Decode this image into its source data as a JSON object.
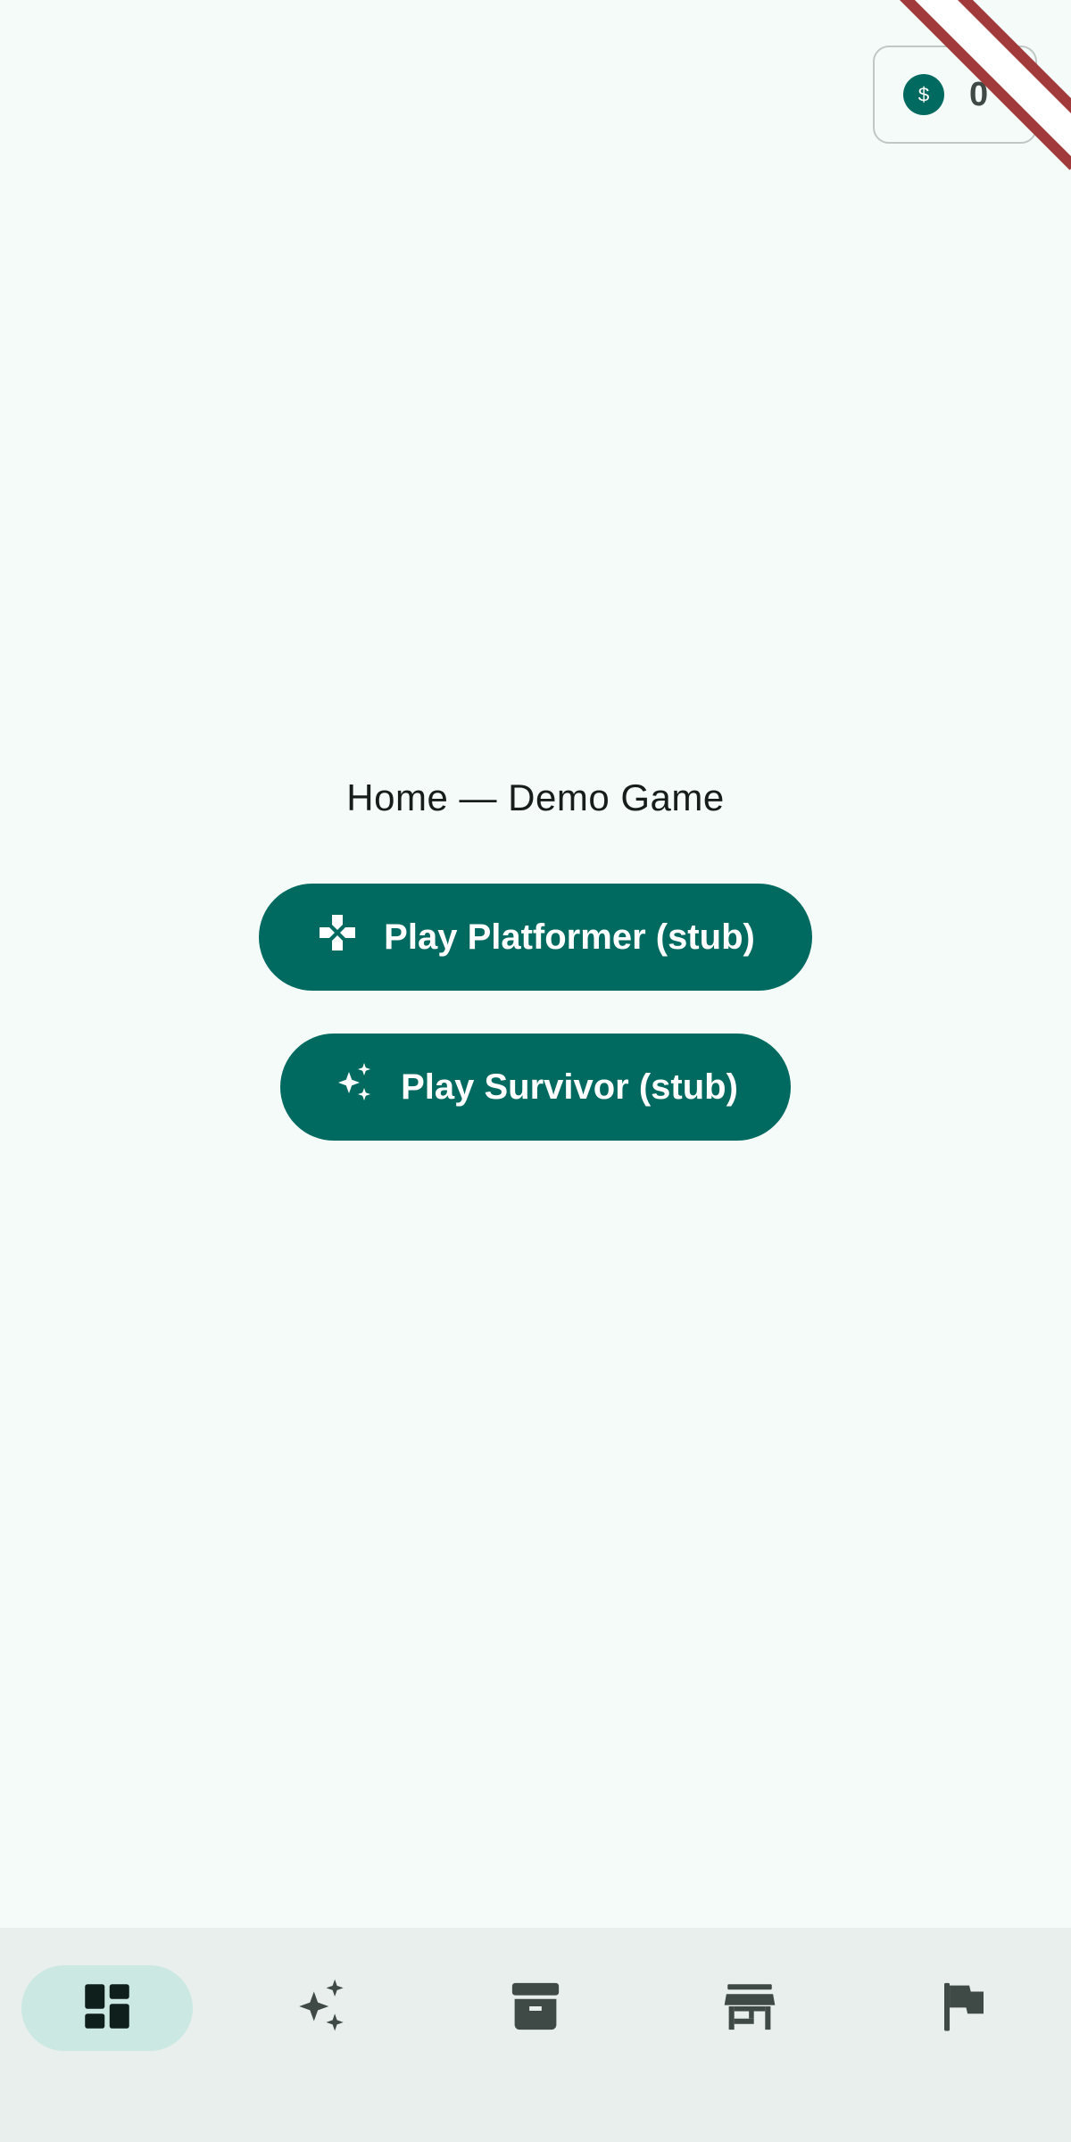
{
  "header": {
    "coins": {
      "icon": "dollar-coin-icon",
      "count": "0"
    }
  },
  "main": {
    "title": "Home — Demo Game",
    "buttons": [
      {
        "label": "Play Platformer (stub)",
        "icon": "gamepad-icon"
      },
      {
        "label": "Play Survivor (stub)",
        "icon": "sparkles-icon"
      }
    ]
  },
  "bottom_nav": {
    "items": [
      {
        "icon": "dashboard-icon",
        "active": true
      },
      {
        "icon": "sparkles-icon",
        "active": false
      },
      {
        "icon": "archive-icon",
        "active": false
      },
      {
        "icon": "store-icon",
        "active": false
      },
      {
        "icon": "flag-icon",
        "active": false
      }
    ]
  },
  "colors": {
    "background": "#f4fbf9",
    "primary": "#006a60",
    "nav_background": "#e9efed",
    "nav_active_pill": "#cce8e2",
    "debug_banner": "#a13b3b"
  }
}
